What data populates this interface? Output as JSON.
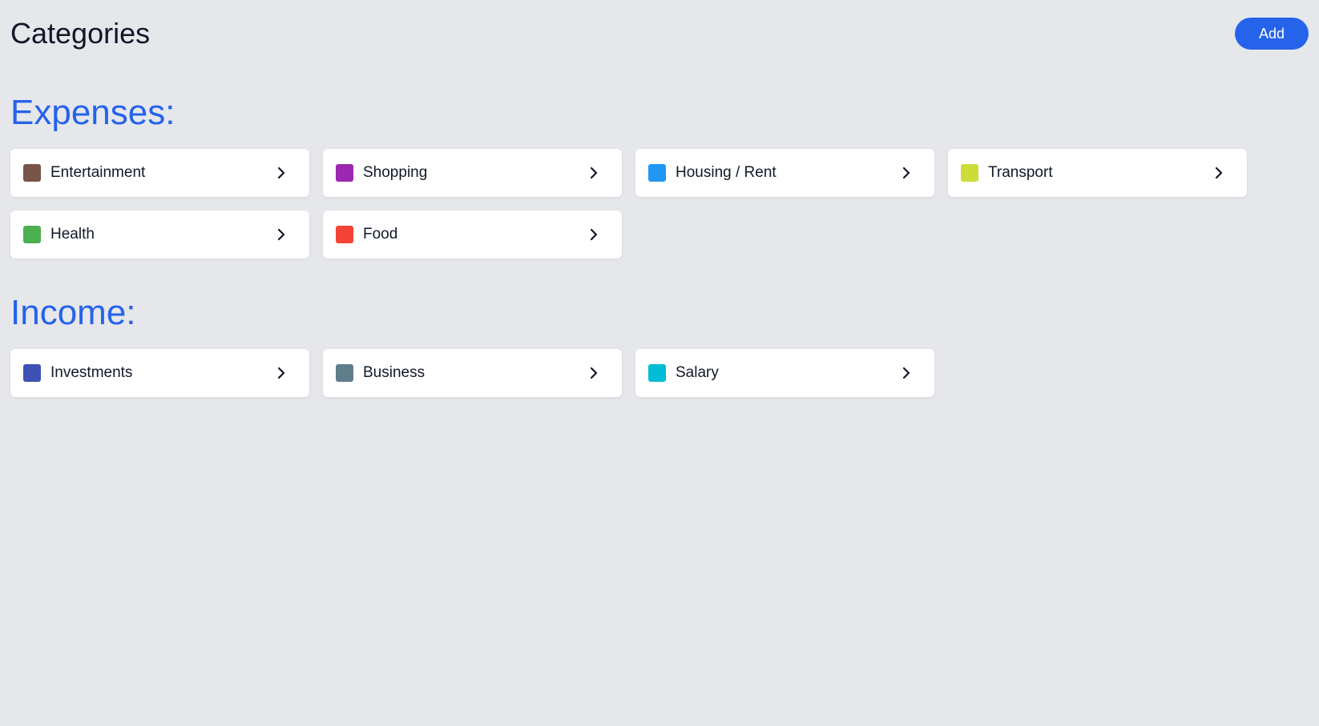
{
  "header": {
    "title": "Categories",
    "add_label": "Add"
  },
  "expenses": {
    "heading": "Expenses:",
    "items": [
      {
        "label": "Entertainment",
        "color": "#795548",
        "icon": "chevron-right-icon"
      },
      {
        "label": "Shopping",
        "color": "#9c27b0",
        "icon": "chevron-right-icon"
      },
      {
        "label": "Housing / Rent",
        "color": "#2196f3",
        "icon": "chevron-right-icon"
      },
      {
        "label": "Transport",
        "color": "#cddc39",
        "icon": "chevron-right-icon"
      },
      {
        "label": "Health",
        "color": "#4caf50",
        "icon": "chevron-right-icon"
      },
      {
        "label": "Food",
        "color": "#f44336",
        "icon": "chevron-right-icon"
      }
    ]
  },
  "income": {
    "heading": "Income:",
    "items": [
      {
        "label": "Investments",
        "color": "#3f51b5",
        "icon": "chevron-right-icon"
      },
      {
        "label": "Business",
        "color": "#607d8b",
        "icon": "chevron-right-icon"
      },
      {
        "label": "Salary",
        "color": "#00bcd4",
        "icon": "chevron-right-icon"
      }
    ]
  },
  "colors": {
    "accent": "#2563eb",
    "background": "#e5e7eb",
    "card": "#ffffff"
  }
}
